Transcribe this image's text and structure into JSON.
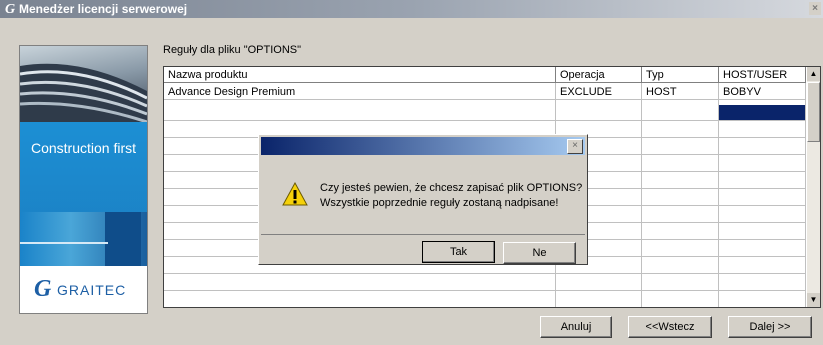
{
  "window": {
    "title": "Menedżer licencji serwerowej",
    "close_glyph": "×"
  },
  "sidebar": {
    "slogan": "Construction first",
    "logo_mark": "G",
    "logo_text": "GRAITEC"
  },
  "rules_label": "Reguły dla pliku \"OPTIONS\"",
  "table": {
    "headers": [
      "Nazwa produktu",
      "Operacja",
      "Typ",
      "HOST/USER"
    ],
    "rows": [
      [
        "Advance Design Premium",
        "EXCLUDE",
        "HOST",
        "BOBYV"
      ]
    ],
    "selected_row": 1,
    "selected_column": 3
  },
  "buttons": {
    "cancel": "Anuluj",
    "back": "<<Wstecz",
    "next": "Dalej >>"
  },
  "dialog": {
    "title": "",
    "close_glyph": "×",
    "message_line1": "Czy jesteś pewien, że chcesz zapisać plik OPTIONS?",
    "message_line2": "Wszystkie poprzednie reguły zostaną nadpisane!",
    "yes_label": "Tak",
    "no_label": "Ne",
    "icon": "warning-icon"
  },
  "colors": {
    "selection": "#0a246a",
    "face": "#d4d0c8",
    "brand_blue": "#1e8ed0"
  }
}
